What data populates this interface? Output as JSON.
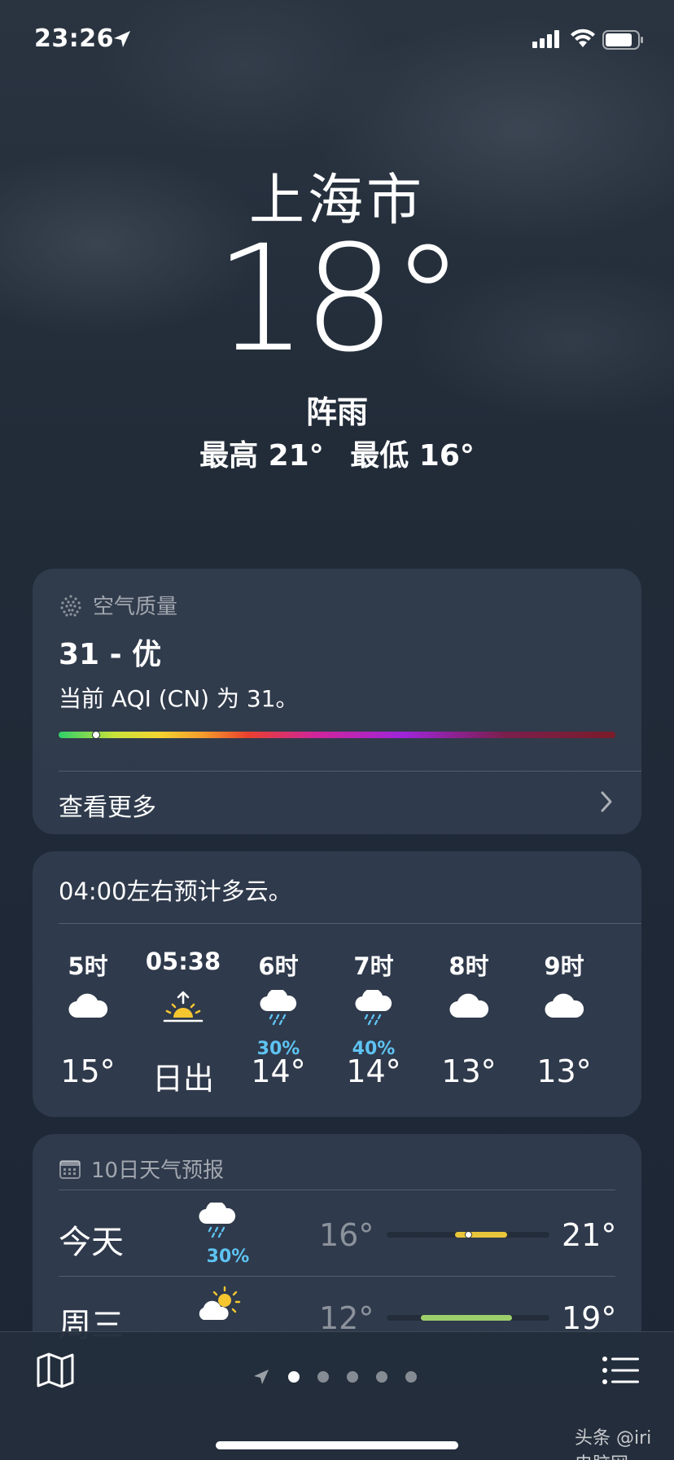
{
  "status": {
    "time": "23:26"
  },
  "header": {
    "city": "上海市",
    "temp": "18°",
    "condition": "阵雨",
    "high": "最高 21°",
    "low": "最低 16°"
  },
  "aqi": {
    "title": "空气质量",
    "value": "31 - 优",
    "description": "当前 AQI (CN) 为 31。",
    "level_fraction": 0.062,
    "see_more": "查看更多"
  },
  "hourly": {
    "note": "04:00左右预计多云。",
    "items": [
      {
        "label": "5时",
        "icon": "cloud-icon",
        "pct": "",
        "temp": "15°"
      },
      {
        "label": "05:38",
        "icon": "sunrise-icon",
        "pct": "",
        "temp": "日出"
      },
      {
        "label": "6时",
        "icon": "cloud-rain-icon",
        "pct": "30%",
        "temp": "14°"
      },
      {
        "label": "7时",
        "icon": "cloud-rain-icon",
        "pct": "40%",
        "temp": "14°"
      },
      {
        "label": "8时",
        "icon": "cloud-icon",
        "pct": "",
        "temp": "13°"
      },
      {
        "label": "9时",
        "icon": "cloud-icon",
        "pct": "",
        "temp": "13°"
      }
    ]
  },
  "daily": {
    "title": "10日天气预报",
    "items": [
      {
        "name": "今天",
        "icon": "cloud-rain-icon",
        "pct": "30%",
        "low": "16°",
        "high": "21°",
        "bar_color": "#e8c53a"
      },
      {
        "name": "周三",
        "icon": "sun-cloud-icon",
        "pct": "",
        "low": "12°",
        "high": "19°",
        "bar_color": "#9ccf6a"
      }
    ]
  },
  "watermark": "头条 @iri 电脑网"
}
